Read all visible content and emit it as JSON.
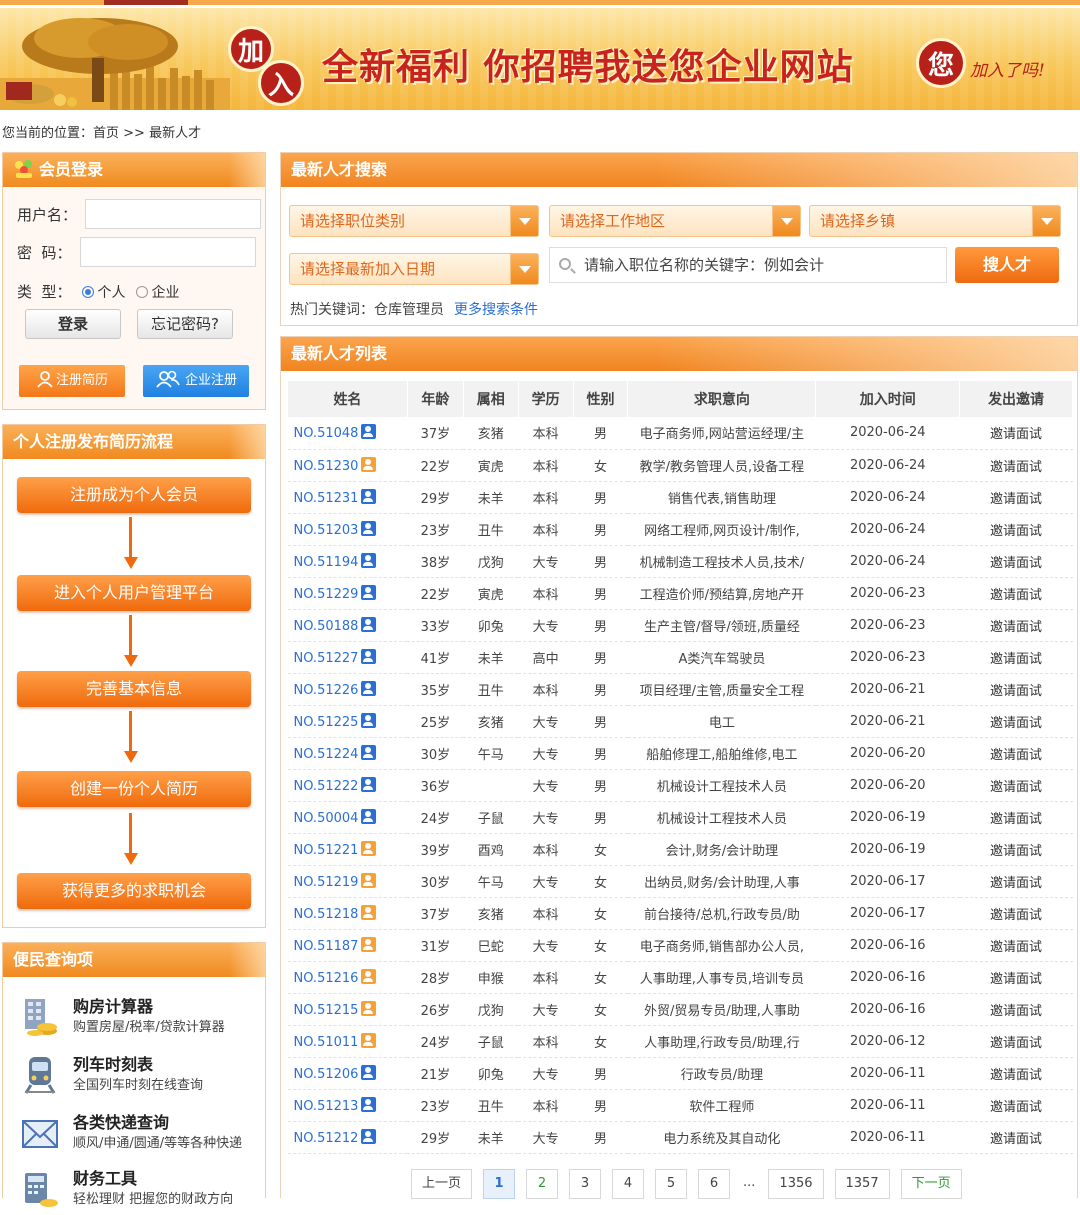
{
  "banner": {
    "circle1": "加",
    "circle2": "入",
    "slogan": "全新福利  你招聘我送您企业网站",
    "circle3": "您",
    "join": "加入了吗!"
  },
  "breadcrumb": {
    "prefix": "您当前的位置：",
    "home": "首页",
    "sep": " >> ",
    "current": "最新人才"
  },
  "login": {
    "title": "会员登录",
    "username_label": "用户名：",
    "password_label": "密  码：",
    "type_label": "类  型：",
    "type_person": "个人",
    "type_company": "企业",
    "login_button": "登录",
    "forgot_button": "忘记密码?",
    "register_resume": "注册简历",
    "register_company": "企业注册"
  },
  "flow": {
    "title": "个人注册发布简历流程",
    "steps": [
      "注册成为个人会员",
      "进入个人用户管理平台",
      "完善基本信息",
      "创建一份个人简历",
      "获得更多的求职机会"
    ]
  },
  "services": {
    "title": "便民查询项",
    "items": [
      {
        "name": "购房计算器",
        "desc": "购置房屋/税率/贷款计算器",
        "icon": "calculator-building-icon"
      },
      {
        "name": "列车时刻表",
        "desc": "全国列车时刻在线查询",
        "icon": "train-icon"
      },
      {
        "name": "各类快递查询",
        "desc": "顺风/申通/圆通/等等各种快递",
        "icon": "envelope-icon"
      },
      {
        "name": "财务工具",
        "desc": "轻松理财 把握您的财政方向",
        "icon": "finance-calculator-icon"
      }
    ]
  },
  "search": {
    "title": "最新人才搜索",
    "job_category": "请选择职位类别",
    "work_area": "请选择工作地区",
    "town": "请选择乡镇",
    "join_date": "请选择最新加入日期",
    "keyword_placeholder": "请输入职位名称的关键字：例如会计",
    "search_button": "搜人才",
    "hot_label": "热门关键词：",
    "hot_keyword": "仓库管理员",
    "more_conditions": "更多搜索条件"
  },
  "talent_list": {
    "title": "最新人才列表",
    "columns": [
      "姓名",
      "年龄",
      "属相",
      "学历",
      "性别",
      "求职意向",
      "加入时间",
      "发出邀请"
    ],
    "invite_text": "邀请面试",
    "rows": [
      {
        "no": "NO.51048",
        "gender_icon": "m",
        "age": "37岁",
        "zodiac": "亥猪",
        "edu": "本科",
        "sex": "男",
        "intent": "电子商务师,网站营运经理/主",
        "date": "2020-06-24"
      },
      {
        "no": "NO.51230",
        "gender_icon": "f",
        "age": "22岁",
        "zodiac": "寅虎",
        "edu": "本科",
        "sex": "女",
        "intent": "教学/教务管理人员,设备工程",
        "date": "2020-06-24"
      },
      {
        "no": "NO.51231",
        "gender_icon": "m",
        "age": "29岁",
        "zodiac": "未羊",
        "edu": "本科",
        "sex": "男",
        "intent": "销售代表,销售助理",
        "date": "2020-06-24"
      },
      {
        "no": "NO.51203",
        "gender_icon": "m",
        "age": "23岁",
        "zodiac": "丑牛",
        "edu": "本科",
        "sex": "男",
        "intent": "网络工程师,网页设计/制作,",
        "date": "2020-06-24"
      },
      {
        "no": "NO.51194",
        "gender_icon": "m",
        "age": "38岁",
        "zodiac": "戊狗",
        "edu": "大专",
        "sex": "男",
        "intent": "机械制造工程技术人员,技术/",
        "date": "2020-06-24"
      },
      {
        "no": "NO.51229",
        "gender_icon": "m",
        "age": "22岁",
        "zodiac": "寅虎",
        "edu": "本科",
        "sex": "男",
        "intent": "工程造价师/预结算,房地产开",
        "date": "2020-06-23"
      },
      {
        "no": "NO.50188",
        "gender_icon": "m",
        "age": "33岁",
        "zodiac": "卯兔",
        "edu": "大专",
        "sex": "男",
        "intent": "生产主管/督导/领班,质量经",
        "date": "2020-06-23"
      },
      {
        "no": "NO.51227",
        "gender_icon": "m",
        "age": "41岁",
        "zodiac": "未羊",
        "edu": "高中",
        "sex": "男",
        "intent": "A类汽车驾驶员",
        "date": "2020-06-23"
      },
      {
        "no": "NO.51226",
        "gender_icon": "m",
        "age": "35岁",
        "zodiac": "丑牛",
        "edu": "本科",
        "sex": "男",
        "intent": "项目经理/主管,质量安全工程",
        "date": "2020-06-21"
      },
      {
        "no": "NO.51225",
        "gender_icon": "m",
        "age": "25岁",
        "zodiac": "亥猪",
        "edu": "大专",
        "sex": "男",
        "intent": "电工",
        "date": "2020-06-21"
      },
      {
        "no": "NO.51224",
        "gender_icon": "m",
        "age": "30岁",
        "zodiac": "午马",
        "edu": "大专",
        "sex": "男",
        "intent": "船舶修理工,船舶维修,电工",
        "date": "2020-06-20"
      },
      {
        "no": "NO.51222",
        "gender_icon": "m",
        "age": "36岁",
        "zodiac": "",
        "edu": "大专",
        "sex": "男",
        "intent": "机械设计工程技术人员",
        "date": "2020-06-20"
      },
      {
        "no": "NO.50004",
        "gender_icon": "m",
        "age": "24岁",
        "zodiac": "子鼠",
        "edu": "大专",
        "sex": "男",
        "intent": "机械设计工程技术人员",
        "date": "2020-06-19"
      },
      {
        "no": "NO.51221",
        "gender_icon": "f",
        "age": "39岁",
        "zodiac": "酉鸡",
        "edu": "本科",
        "sex": "女",
        "intent": "会计,财务/会计助理",
        "date": "2020-06-19"
      },
      {
        "no": "NO.51219",
        "gender_icon": "f",
        "age": "30岁",
        "zodiac": "午马",
        "edu": "大专",
        "sex": "女",
        "intent": "出纳员,财务/会计助理,人事",
        "date": "2020-06-17"
      },
      {
        "no": "NO.51218",
        "gender_icon": "f",
        "age": "37岁",
        "zodiac": "亥猪",
        "edu": "本科",
        "sex": "女",
        "intent": "前台接待/总机,行政专员/助",
        "date": "2020-06-17"
      },
      {
        "no": "NO.51187",
        "gender_icon": "f",
        "age": "31岁",
        "zodiac": "巳蛇",
        "edu": "大专",
        "sex": "女",
        "intent": "电子商务师,销售部办公人员,",
        "date": "2020-06-16"
      },
      {
        "no": "NO.51216",
        "gender_icon": "f",
        "age": "28岁",
        "zodiac": "申猴",
        "edu": "本科",
        "sex": "女",
        "intent": "人事助理,人事专员,培训专员",
        "date": "2020-06-16"
      },
      {
        "no": "NO.51215",
        "gender_icon": "f",
        "age": "26岁",
        "zodiac": "戊狗",
        "edu": "大专",
        "sex": "女",
        "intent": "外贸/贸易专员/助理,人事助",
        "date": "2020-06-16"
      },
      {
        "no": "NO.51011",
        "gender_icon": "f",
        "age": "24岁",
        "zodiac": "子鼠",
        "edu": "本科",
        "sex": "女",
        "intent": "人事助理,行政专员/助理,行",
        "date": "2020-06-12"
      },
      {
        "no": "NO.51206",
        "gender_icon": "m",
        "age": "21岁",
        "zodiac": "卯兔",
        "edu": "大专",
        "sex": "男",
        "intent": "行政专员/助理",
        "date": "2020-06-11"
      },
      {
        "no": "NO.51213",
        "gender_icon": "m",
        "age": "23岁",
        "zodiac": "丑牛",
        "edu": "本科",
        "sex": "男",
        "intent": "软件工程师",
        "date": "2020-06-11"
      },
      {
        "no": "NO.51212",
        "gender_icon": "m",
        "age": "29岁",
        "zodiac": "未羊",
        "edu": "大专",
        "sex": "男",
        "intent": "电力系统及其自动化",
        "date": "2020-06-11"
      }
    ]
  },
  "pagination": {
    "prev": "上一页",
    "pages": [
      "1",
      "2",
      "3",
      "4",
      "5",
      "6"
    ],
    "current": "1",
    "ellipsis": "...",
    "tail": [
      "1356",
      "1357"
    ],
    "next": "下一页"
  },
  "colors": {
    "accent_orange": "#f08420",
    "link_blue": "#2a6fd6",
    "brand_red": "#b8201a"
  }
}
